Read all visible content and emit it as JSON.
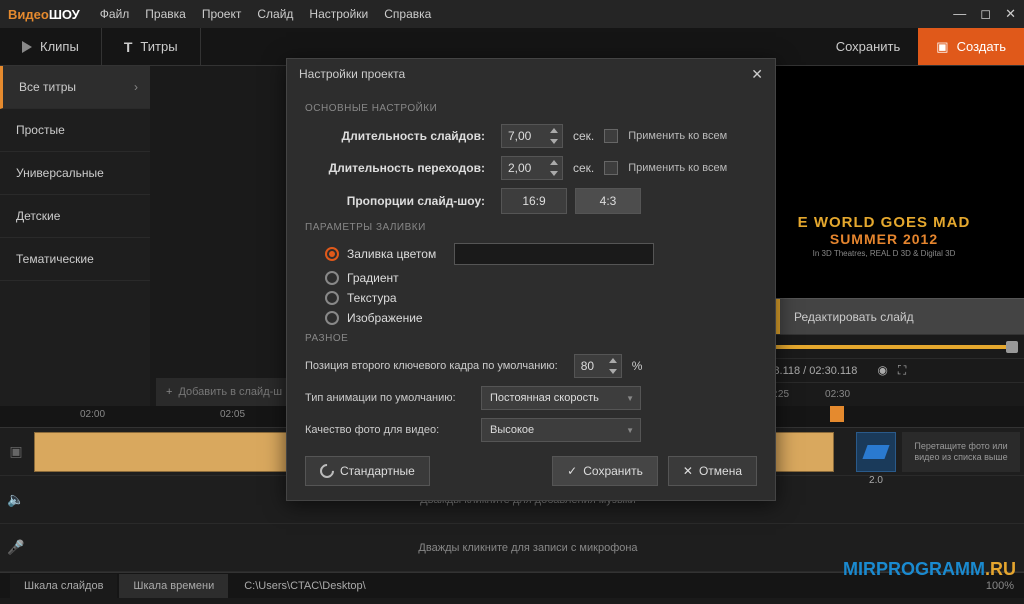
{
  "app": {
    "logo1": "Видео",
    "logo2": "ШОУ"
  },
  "menu": [
    "Файл",
    "Правка",
    "Проект",
    "Слайд",
    "Настройки",
    "Справка"
  ],
  "toolbar": {
    "clips": "Клипы",
    "titles": "Титры",
    "save": "Сохранить",
    "create": "Создать"
  },
  "sidebar": {
    "items": [
      "Все титры",
      "Простые",
      "Универсальные",
      "Детские",
      "Тематические"
    ]
  },
  "addslide": "Добавить в слайд-ш",
  "preview": {
    "l1": "E WORLD GOES MAD",
    "l2": "SUMMER 2012",
    "l3": "In 3D Theatres, REAL D 3D & Digital 3D",
    "edit": "Редактировать слайд"
  },
  "time": {
    "pos": "02:28.118 / 02:30.118",
    "ticks": [
      "02:25",
      "02:30"
    ]
  },
  "ruler": {
    "t1": "02:00",
    "t2": "02:05"
  },
  "clip2_dur": "2.0",
  "dropzone": "Перетащите фото или видео из списка выше",
  "track_music": "Дважды кликните для добавления музыки",
  "track_mic": "Дважды кликните для записи с микрофона",
  "status": {
    "tab1": "Шкала слайдов",
    "tab2": "Шкала времени",
    "path": "C:\\Users\\CTAC\\Desktop\\",
    "zoom": "100%"
  },
  "dialog": {
    "title": "Настройки проекта",
    "sec_main": "ОСНОВНЫЕ НАСТРОЙКИ",
    "slide_dur_label": "Длительность слайдов:",
    "slide_dur": "7,00",
    "trans_dur_label": "Длительность переходов:",
    "trans_dur": "2,00",
    "sec_unit": "сек.",
    "apply_all": "Применить ко всем",
    "aspect_label": "Пропорции слайд-шоу:",
    "aspect1": "16:9",
    "aspect2": "4:3",
    "sec_fill": "ПАРАМЕТРЫ ЗАЛИВКИ",
    "fill_color": "Заливка цветом",
    "fill_grad": "Градиент",
    "fill_tex": "Текстура",
    "fill_img": "Изображение",
    "sec_misc": "РАЗНОЕ",
    "keyframe_label": "Позиция второго ключевого кадра по умолчанию:",
    "keyframe": "80",
    "keyframe_unit": "%",
    "anim_label": "Тип анимации по умолчанию:",
    "anim_val": "Постоянная скорость",
    "quality_label": "Качество фото для видео:",
    "quality_val": "Высокое",
    "btn_default": "Стандартные",
    "btn_save": "Сохранить",
    "btn_cancel": "Отмена"
  },
  "watermark": {
    "p1": "MIRPROGRAMM",
    "p2": ".RU"
  }
}
